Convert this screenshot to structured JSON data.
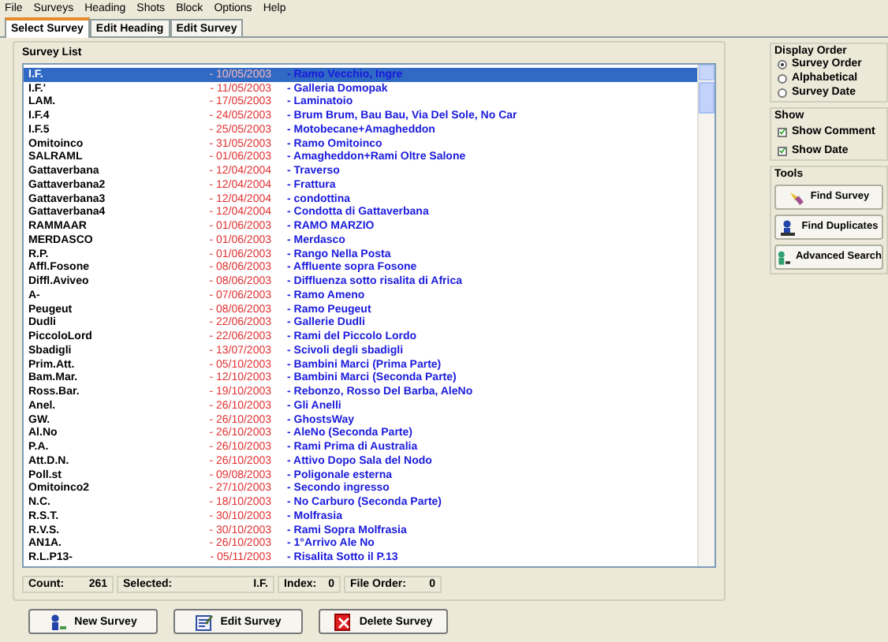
{
  "menu": [
    "File",
    "Surveys",
    "Heading",
    "Shots",
    "Block",
    "Options",
    "Help"
  ],
  "tabs": [
    {
      "label": "Select Survey",
      "selected": true
    },
    {
      "label": "Edit Heading",
      "selected": false
    },
    {
      "label": "Edit Survey",
      "selected": false
    }
  ],
  "survey_list": {
    "title": "Survey List",
    "rows": [
      {
        "name": "I.F.",
        "date": "- 10/05/2003",
        "description": "- Ramo Vecchio, Ingre",
        "selected": true
      },
      {
        "name": "I.F.'",
        "date": "- 11/05/2003",
        "description": "- Galleria Domopak",
        "selected": false
      },
      {
        "name": "LAM.",
        "date": "- 17/05/2003",
        "description": "- Laminatoio",
        "selected": false
      },
      {
        "name": "I.F.4",
        "date": "- 24/05/2003",
        "description": "- Brum Brum, Bau Bau, Via Del Sole, No Car",
        "selected": false
      },
      {
        "name": "I.F.5",
        "date": "- 25/05/2003",
        "description": "- Motobecane+Amaghеddon",
        "selected": false
      },
      {
        "name": "Omitoinco",
        "date": "- 31/05/2003",
        "description": "- Ramo Omitoinco",
        "selected": false
      },
      {
        "name": "SALRAML",
        "date": "- 01/06/2003",
        "description": "- Amaghеddon+Rami Oltre Salone",
        "selected": false
      },
      {
        "name": "Gattaverbana",
        "date": "- 12/04/2004",
        "description": "- Traverso",
        "selected": false
      },
      {
        "name": "Gattaverbana2",
        "date": "- 12/04/2004",
        "description": "- Frattura",
        "selected": false
      },
      {
        "name": "Gattaverbana3",
        "date": "- 12/04/2004",
        "description": "- condottina",
        "selected": false
      },
      {
        "name": "Gattaverbana4",
        "date": "- 12/04/2004",
        "description": "- Condotta di Gattaverbana",
        "selected": false
      },
      {
        "name": "RAMMAAR",
        "date": "- 01/06/2003",
        "description": "- RAMO MARZIO",
        "selected": false
      },
      {
        "name": "MERDASCO",
        "date": "- 01/06/2003",
        "description": "- Merdasco",
        "selected": false
      },
      {
        "name": "R.P.",
        "date": "- 01/06/2003",
        "description": "- Rango Nella Posta",
        "selected": false
      },
      {
        "name": "Affl.Fosone",
        "date": "- 08/06/2003",
        "description": "- Affluente sopra Fosone",
        "selected": false
      },
      {
        "name": "Diffl.Aviveo",
        "date": "- 08/06/2003",
        "description": "- Diffluenza sotto risalita di Africa",
        "selected": false
      },
      {
        "name": "A-",
        "date": "- 07/06/2003",
        "description": "- Ramo Ameno",
        "selected": false
      },
      {
        "name": "Peugeut",
        "date": "- 08/06/2003",
        "description": "- Ramo Peugeut",
        "selected": false
      },
      {
        "name": "Dudli",
        "date": "- 22/06/2003",
        "description": "- Gallerie Dudli",
        "selected": false
      },
      {
        "name": "PiccoloLord",
        "date": "- 22/06/2003",
        "description": "- Rami del Piccolo Lordo",
        "selected": false
      },
      {
        "name": "Sbadigli",
        "date": "- 13/07/2003",
        "description": "- Scivoli degli sbadigli",
        "selected": false
      },
      {
        "name": "Prim.Att.",
        "date": "- 05/10/2003",
        "description": "- Bambini Marci (Prima Parte)",
        "selected": false
      },
      {
        "name": "Bam.Mar.",
        "date": "- 12/10/2003",
        "description": "- Bambini Marci (Seconda Parte)",
        "selected": false
      },
      {
        "name": "Ross.Bar.",
        "date": "- 19/10/2003",
        "description": "- Rebonzo, Rosso Del Barba, AleNo",
        "selected": false
      },
      {
        "name": "Anel.",
        "date": "- 26/10/2003",
        "description": "- Gli Anelli",
        "selected": false
      },
      {
        "name": "GW.",
        "date": "- 26/10/2003",
        "description": "- GhostsWay",
        "selected": false
      },
      {
        "name": "Al.No",
        "date": "- 26/10/2003",
        "description": "- AleNo (Seconda Parte)",
        "selected": false
      },
      {
        "name": "P.A.",
        "date": "- 26/10/2003",
        "description": "- Rami Prima di Australia",
        "selected": false
      },
      {
        "name": "Att.D.N.",
        "date": "- 26/10/2003",
        "description": "- Attivo Dopo Sala del Nodo",
        "selected": false
      },
      {
        "name": "Poll.st",
        "date": "- 09/08/2003",
        "description": "- Poligonale esterna",
        "selected": false
      },
      {
        "name": "Omitoinco2",
        "date": "- 27/10/2003",
        "description": "- Secondo ingresso",
        "selected": false
      },
      {
        "name": "N.C.",
        "date": "- 18/10/2003",
        "description": "- No Carburo (Seconda Parte)",
        "selected": false
      },
      {
        "name": "R.S.T.",
        "date": "- 30/10/2003",
        "description": "- Molfrasia",
        "selected": false
      },
      {
        "name": "R.V.S.",
        "date": "- 30/10/2003",
        "description": "- Rami Sopra Molfrasia",
        "selected": false
      },
      {
        "name": "AN1A.",
        "date": "- 26/10/2003",
        "description": "- 1°Arrivo Ale No",
        "selected": false
      },
      {
        "name": "R.L.P13-",
        "date": "- 05/11/2003",
        "description": "- Risalita Sotto il P.13",
        "selected": false
      }
    ]
  },
  "status": [
    {
      "label": "Count:",
      "value": "261"
    },
    {
      "label": "Selected:",
      "value": "I.F."
    },
    {
      "label": "Index:",
      "value": "0"
    },
    {
      "label": "File Order:",
      "value": "0"
    }
  ],
  "buttons": [
    {
      "label": "New Survey",
      "kind": "new"
    },
    {
      "label": "Edit Survey",
      "kind": "edit"
    },
    {
      "label": "Delete Survey",
      "kind": "delete"
    }
  ],
  "display_order": {
    "title": "Display Order",
    "options": [
      {
        "label": "Survey Order",
        "selected": true
      },
      {
        "label": "Alphabetical",
        "selected": false
      },
      {
        "label": "Survey Date",
        "selected": false
      }
    ]
  },
  "show": {
    "title": "Show",
    "options": [
      {
        "label": "Show Comment",
        "checked": true
      },
      {
        "label": "Show Date",
        "checked": true
      }
    ]
  },
  "tools": {
    "title": "Tools",
    "buttons": [
      {
        "label": "Find Survey",
        "kind": "find"
      },
      {
        "label": "Find Duplicates",
        "kind": "duplicates"
      },
      {
        "label": "Advanced Search",
        "kind": "advanced"
      }
    ]
  }
}
